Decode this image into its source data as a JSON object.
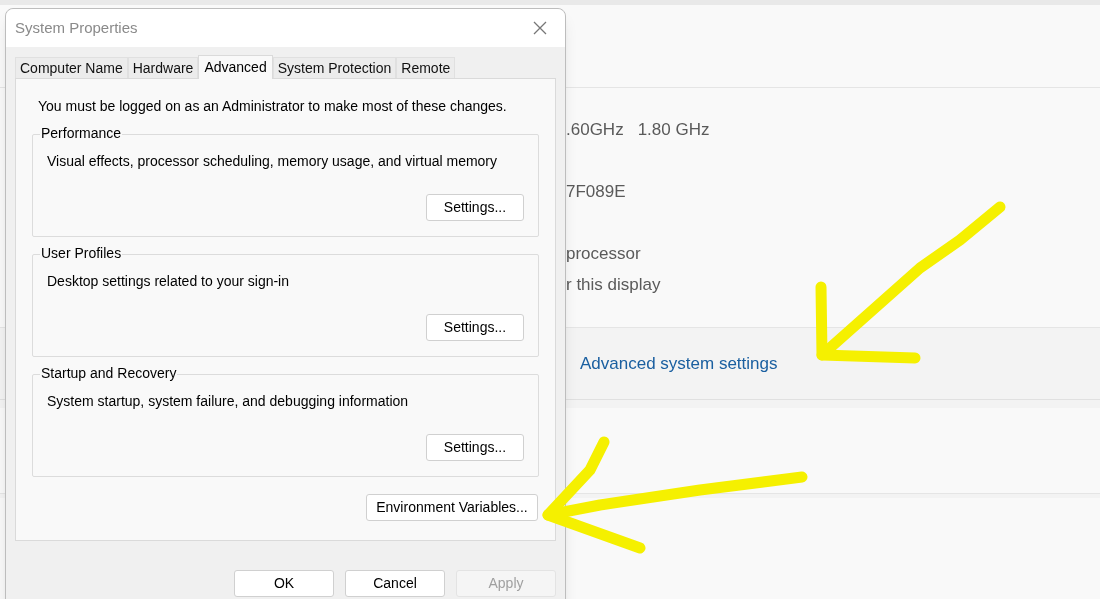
{
  "settings_page": {
    "spec_rows": [
      {
        "kind": "field",
        "values": [
          ".60GHz",
          "1.80 GHz"
        ]
      },
      {
        "kind": "field",
        "values": [
          "7F089E"
        ]
      },
      {
        "kind": "line",
        "values": [
          "processor"
        ]
      },
      {
        "kind": "line",
        "values": [
          "r this display"
        ]
      }
    ],
    "link": "Advanced system settings"
  },
  "dialog": {
    "title": "System Properties",
    "tabs": [
      {
        "label": "Computer Name",
        "selected": false
      },
      {
        "label": "Hardware",
        "selected": false
      },
      {
        "label": "Advanced",
        "selected": true
      },
      {
        "label": "System Protection",
        "selected": false
      },
      {
        "label": "Remote",
        "selected": false
      }
    ],
    "notice": "You must be logged on as an Administrator to make most of these changes.",
    "groups": [
      {
        "title": "Performance",
        "description": "Visual effects, processor scheduling, memory usage, and virtual memory",
        "button": "Settings..."
      },
      {
        "title": "User Profiles",
        "description": "Desktop settings related to your sign-in",
        "button": "Settings..."
      },
      {
        "title": "Startup and Recovery",
        "description": "System startup, system failure, and debugging information",
        "button": "Settings..."
      }
    ],
    "extra_button": "Environment Variables...",
    "buttons": [
      {
        "label": "OK",
        "disabled": false
      },
      {
        "label": "Cancel",
        "disabled": false
      },
      {
        "label": "Apply",
        "disabled": true
      }
    ]
  }
}
